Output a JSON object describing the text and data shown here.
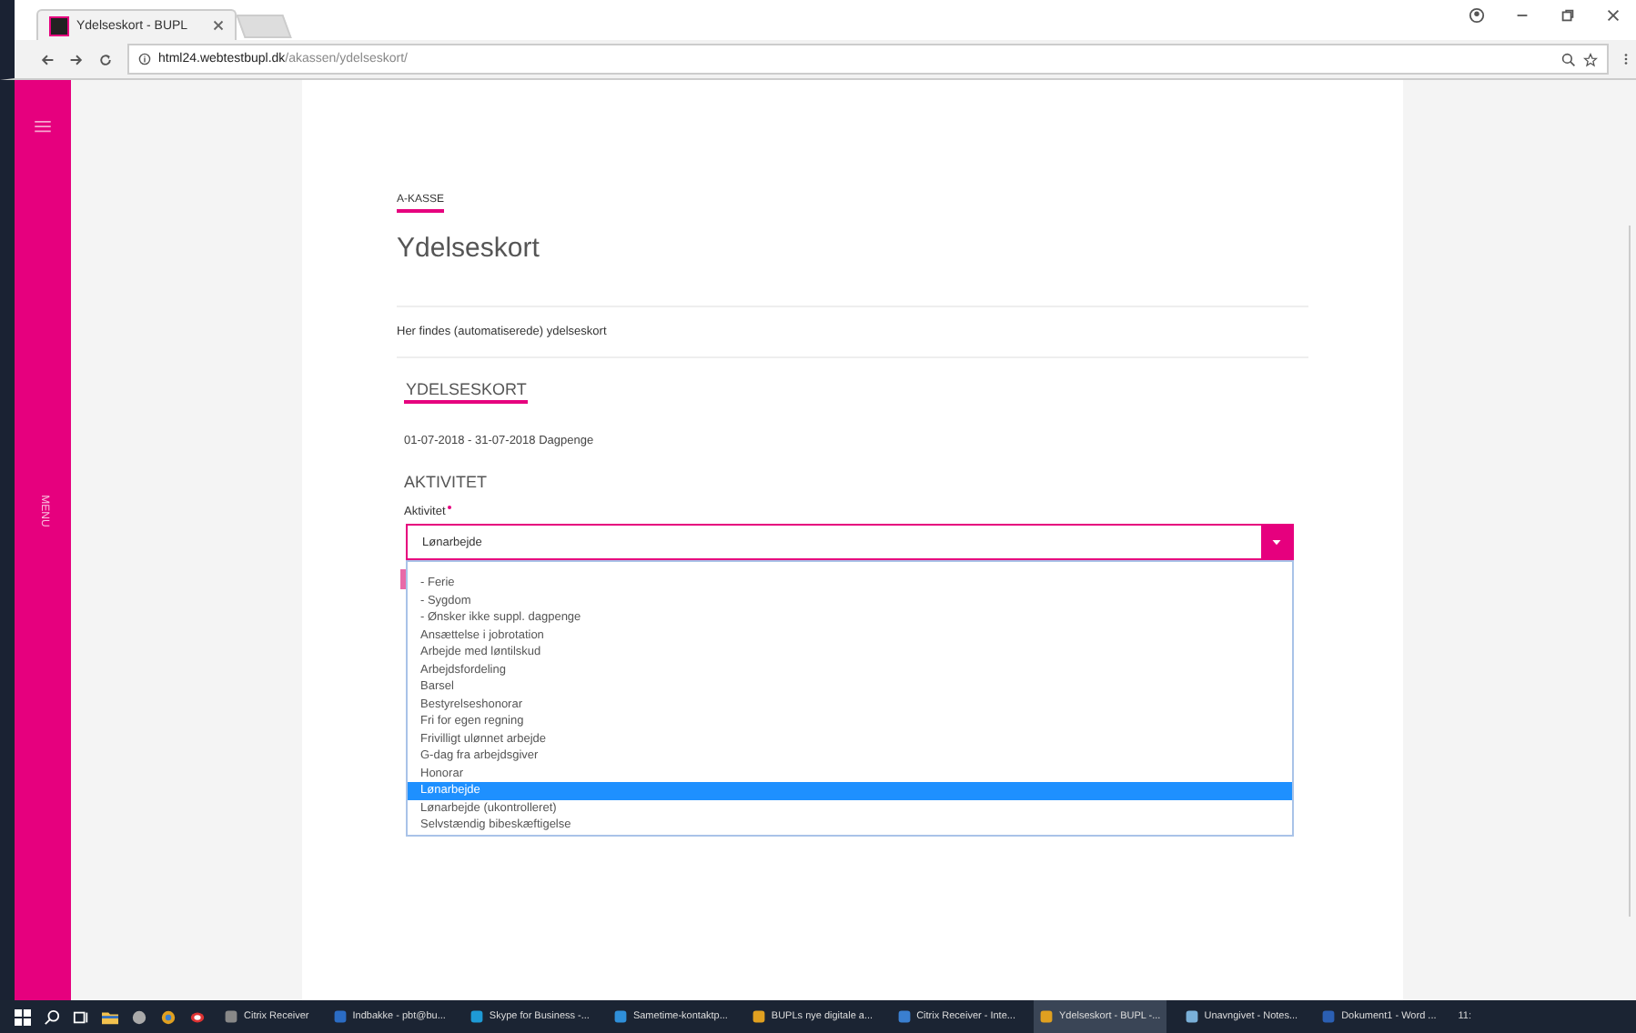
{
  "browser": {
    "tab_title": "Ydelseskort - BUPL",
    "url_host": "html24.webtestbupl.dk",
    "url_path": "/akassen/ydelseskort/"
  },
  "sidebar": {
    "menu_label": "MENU"
  },
  "page": {
    "breadcrumb": "A-KASSE",
    "title": "Ydelseskort",
    "intro": "Her findes (automatiserede) ydelseskort",
    "section": "YDELSESKORT",
    "period": "01-07-2018 - 31-07-2018 Dagpenge",
    "subsection": "AKTIVITET",
    "field_label": "Aktivitet",
    "required": true,
    "field_value": "Lønarbejde",
    "dropdown_expanded": true
  },
  "options": [
    {
      "label": "- Ferie",
      "selected": false
    },
    {
      "label": "- Sygdom",
      "selected": false
    },
    {
      "label": "- Ønsker ikke suppl. dagpenge",
      "selected": false
    },
    {
      "label": "Ansættelse i jobrotation",
      "selected": false
    },
    {
      "label": "Arbejde med løntilskud",
      "selected": false
    },
    {
      "label": "Arbejdsfordeling",
      "selected": false
    },
    {
      "label": "Barsel",
      "selected": false
    },
    {
      "label": "Bestyrelseshonorar",
      "selected": false
    },
    {
      "label": "Fri for egen regning",
      "selected": false
    },
    {
      "label": "Frivilligt ulønnet arbejde",
      "selected": false
    },
    {
      "label": "G-dag fra arbejdsgiver",
      "selected": false
    },
    {
      "label": "Honorar",
      "selected": false
    },
    {
      "label": "Lønarbejde",
      "selected": true
    },
    {
      "label": "Lønarbejde (ukontrolleret)",
      "selected": false
    },
    {
      "label": "Selvstændig bibeskæftigelse",
      "selected": false
    }
  ],
  "taskbar": {
    "apps": [
      {
        "label": "Citrix Receiver",
        "active": false
      },
      {
        "label": "Indbakke - pbt@bu...",
        "active": false
      },
      {
        "label": "Skype for Business -...",
        "active": false
      },
      {
        "label": "Sametime-kontaktp...",
        "active": false
      },
      {
        "label": "BUPLs nye digitale a...",
        "active": false
      },
      {
        "label": "Citrix Receiver - Inte...",
        "active": false
      },
      {
        "label": "Ydelseskort - BUPL -...",
        "active": true
      },
      {
        "label": "Unavngivet - Notes...",
        "active": false
      },
      {
        "label": "Dokument1 - Word ...",
        "active": false
      }
    ],
    "clock": "11:"
  }
}
